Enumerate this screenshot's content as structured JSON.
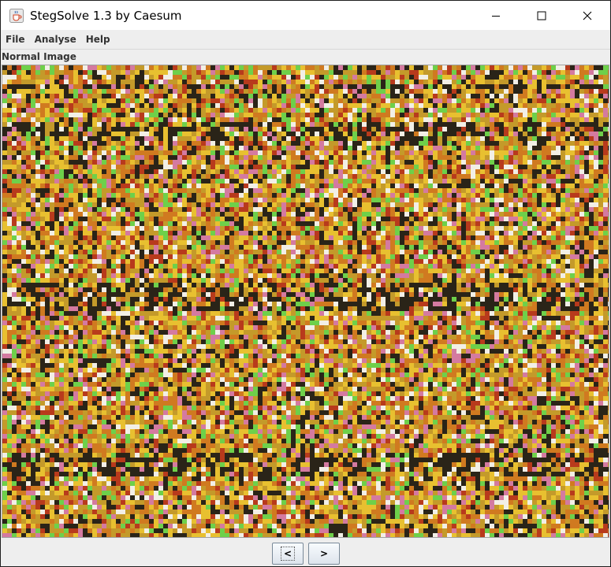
{
  "window": {
    "title": "StegSolve 1.3 by Caesum",
    "app_icon": "java-coffee-cup-icon"
  },
  "menu": {
    "items": [
      "File",
      "Analyse",
      "Help"
    ]
  },
  "viewer": {
    "label": "Normal Image",
    "image_description": "autostereogram-noise-pattern",
    "colors": {
      "base": "#c49a2a",
      "yellow": "#e8c030",
      "orange": "#d07a20",
      "dark": "#2a2418",
      "green": "#6ed04a",
      "white": "#f2efe6",
      "pink": "#d47aa0",
      "red": "#b83a1c"
    }
  },
  "navigation": {
    "prev_label": "<",
    "next_label": ">"
  }
}
